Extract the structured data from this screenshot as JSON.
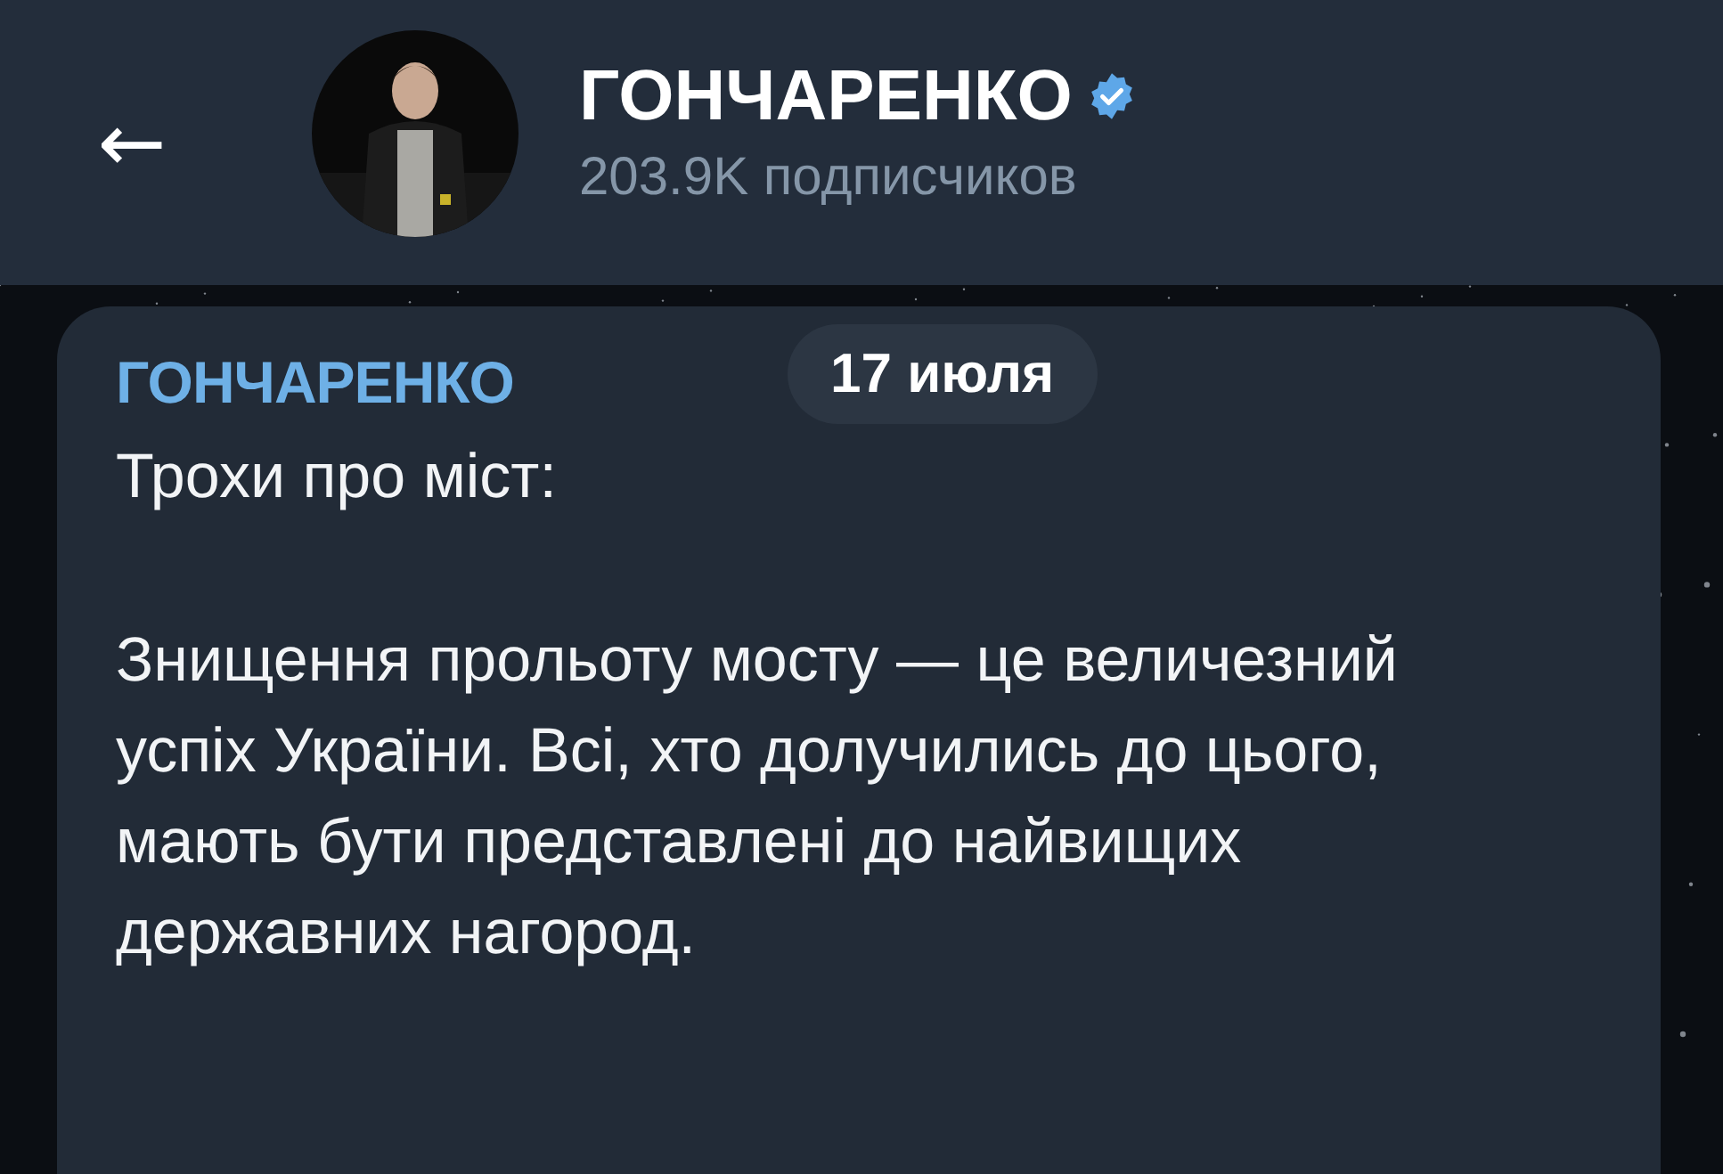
{
  "header": {
    "back_icon": "←",
    "title": "ГОНЧАРЕНКО",
    "verified": true,
    "subtitle": "203.9K подписчиков"
  },
  "message": {
    "sender": "ГОНЧАРЕНКО",
    "date": "17 июля",
    "paragraphs": [
      "Трохи про міст:",
      "Знищення прольоту мосту — це величезний успіх України. Всі, хто долучились до цього, мають бути представлені до найвищих державних нагород."
    ]
  }
}
